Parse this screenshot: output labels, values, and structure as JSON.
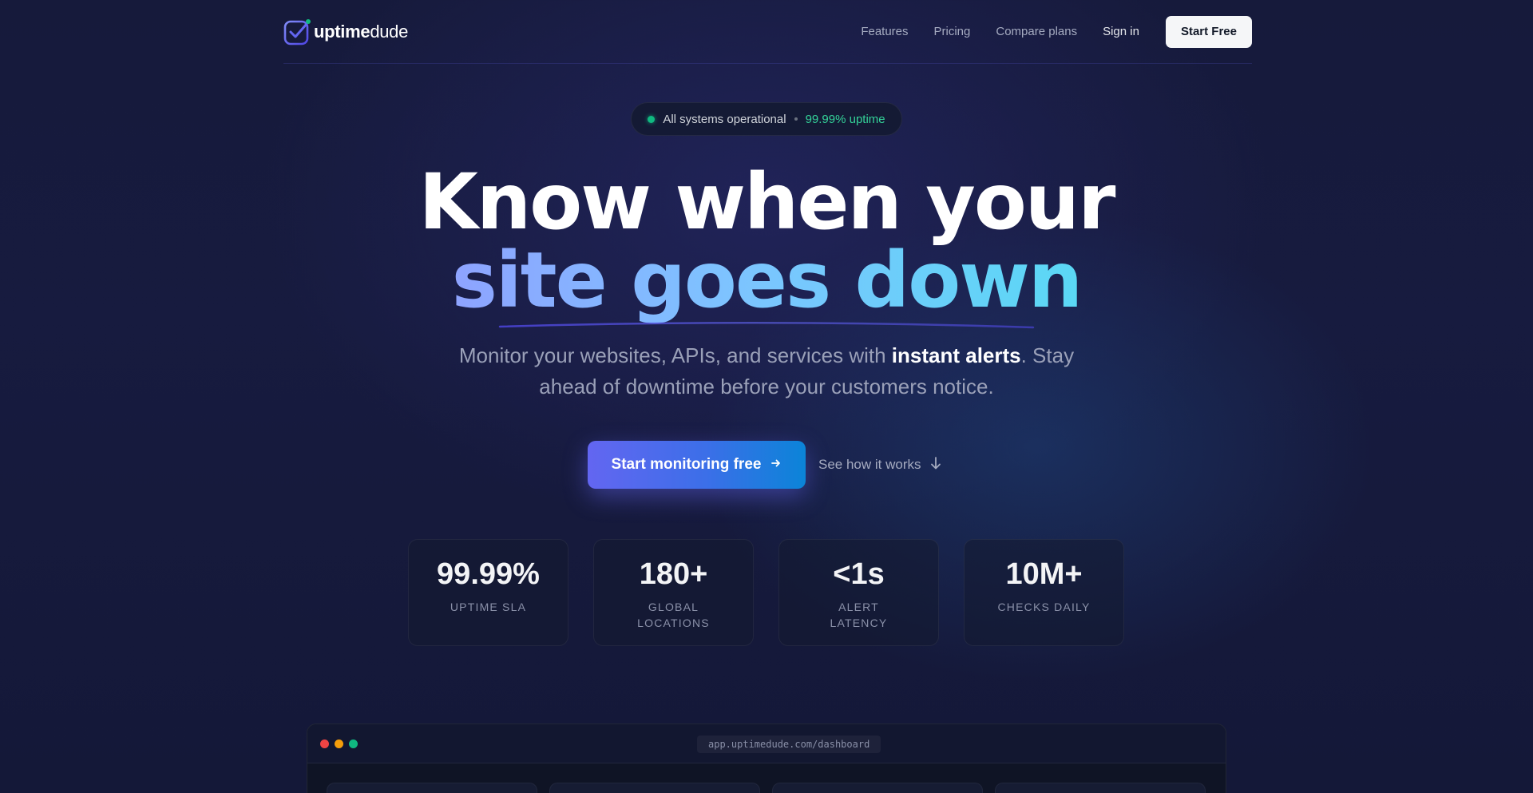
{
  "nav": {
    "brand_bold": "uptime",
    "brand_light": "dude",
    "links": [
      "Features",
      "Pricing",
      "Compare plans"
    ],
    "signin": "Sign in",
    "cta": "Start Free"
  },
  "status": {
    "text": "All systems operational",
    "uptime": "99.99% uptime"
  },
  "hero": {
    "line1": "Know when your",
    "line2": "site goes down",
    "subtitle_pre": "Monitor your websites, APIs, and services with ",
    "subtitle_bold": "instant alerts",
    "subtitle_post": ". Stay ahead of downtime before your customers notice."
  },
  "cta": {
    "primary": "Start monitoring free",
    "secondary": "See how it works"
  },
  "stats": [
    {
      "value": "99.99%",
      "label": "UPTIME SLA"
    },
    {
      "value": "180+",
      "label": "GLOBAL LOCATIONS"
    },
    {
      "value": "<1s",
      "label": "ALERT LATENCY"
    },
    {
      "value": "10M+",
      "label": "CHECKS DAILY"
    }
  ],
  "preview": {
    "url": "app.uptimedude.com/dashboard"
  },
  "colors": {
    "accent": "#6366f1",
    "success": "#10b981",
    "background": "#161a3b"
  }
}
